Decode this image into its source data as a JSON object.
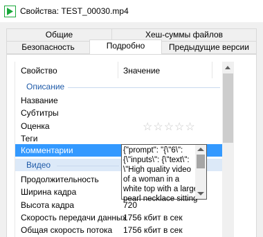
{
  "window": {
    "title": "Свойства: TEST_00030.mp4"
  },
  "tabs_row1": [
    {
      "label": "Общие"
    },
    {
      "label": "Хеш-суммы файлов"
    }
  ],
  "tabs_row2": [
    {
      "label": "Безопасность"
    },
    {
      "label": "Подробно"
    },
    {
      "label": "Предыдущие версии"
    }
  ],
  "active_tab": "Подробно",
  "columns": {
    "property": "Свойство",
    "value": "Значение"
  },
  "groups": {
    "description": "Описание",
    "video": "Видео"
  },
  "rows": [
    {
      "prop": "Название",
      "val": ""
    },
    {
      "prop": "Субтитры",
      "val": ""
    },
    {
      "prop": "Оценка",
      "val": "",
      "stars": "☆☆☆☆☆",
      "rating": 0
    },
    {
      "prop": "Теги",
      "val": ""
    },
    {
      "prop": "Комментарии",
      "val": ""
    },
    {
      "prop": "Продолжительность",
      "val": ""
    },
    {
      "prop": "Ширина кадра",
      "val": ""
    },
    {
      "prop": "Высота кадра",
      "val": "720"
    },
    {
      "prop": "Скорость передачи данных",
      "val": "1756 кбит в сек"
    },
    {
      "prop": "Общая скорость потока",
      "val": "1756 кбит в сек"
    }
  ],
  "comment_edit": {
    "text": "{\"prompt\": \"{\\\"6\\\": \n{\\\"inputs\\\": {\\\"text\\\": \n\\\"High quality video \nof a woman in a \nwhite top with a large \npearl necklace sitting"
  },
  "colors": {
    "selection": "#3399ff",
    "group_text": "#1e5aa8",
    "icon_green": "#1aa83a"
  }
}
